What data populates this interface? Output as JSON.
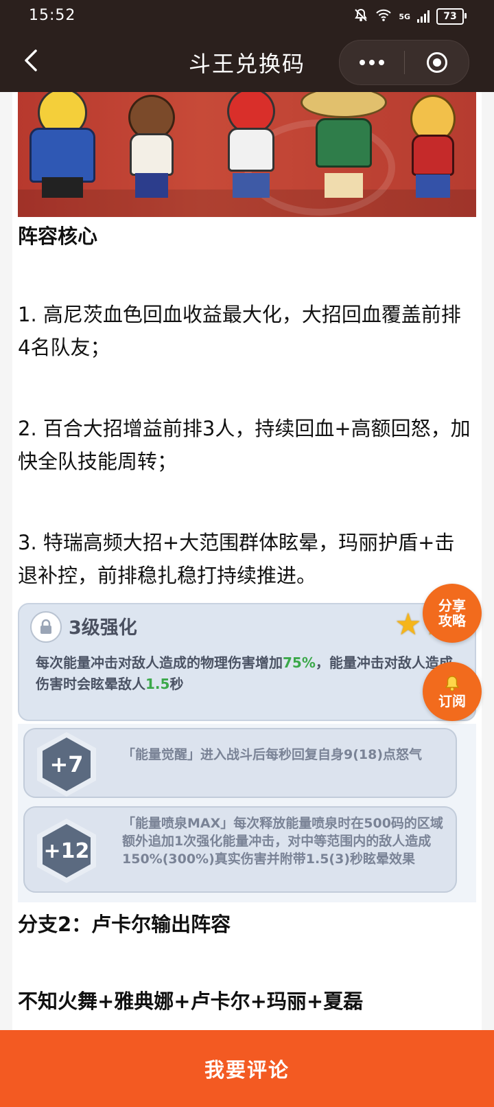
{
  "status_bar": {
    "time": "15:52",
    "network": "5G",
    "battery": "73"
  },
  "nav": {
    "title": "斗王兑换码",
    "back_icon": "chevron-left-icon",
    "more_icon": "more-dots-icon",
    "close_icon": "target-close-icon"
  },
  "article": {
    "section_title": "阵容核心",
    "point1": "1. 高尼茨血色回血收益最大化，大招回血覆盖前排4名队友；",
    "point2": "2. 百合大招增益前排3人，持续回血+高额回怒，加快全队技能周转；",
    "point3": "3. 特瑞高频大招+大范围群体眩晕，玛丽护盾+击退补控，前排稳扎稳打持续推进。",
    "skill_card": {
      "title": "3级强化",
      "desc_part1": "每次能量冲击对敌人造成的物理伤害增加",
      "desc_value1": "75%",
      "desc_part2": "，能量冲击对敌人造成伤害时会眩晕敌人",
      "desc_value2": "1.5",
      "desc_part3": "秒",
      "stars": 2
    },
    "talents": [
      {
        "badge": "+7",
        "text": "「能量觉醒」进入战斗后每秒回复自身9(18)点怒气"
      },
      {
        "badge": "+12",
        "text": "「能量喷泉MAX」每次释放能量喷泉时在500码的区域额外追加1次强化能量冲击，对中等范围内的敌人造成150%(300%)真实伤害并附带1.5(3)秒眩晕效果"
      }
    ],
    "branch_title": "分支2：卢卡尔输出阵容",
    "lineup_partial": "不知火舞+雅典娜+卢卡尔+玛丽+夏磊"
  },
  "fabs": {
    "share": [
      "分享",
      "攻略"
    ],
    "subscribe": "订阅"
  },
  "bottom": {
    "comment_label": "我要评论"
  },
  "colors": {
    "accent": "#f35a22",
    "topbar": "#2b201d",
    "green": "#3ba84a"
  }
}
